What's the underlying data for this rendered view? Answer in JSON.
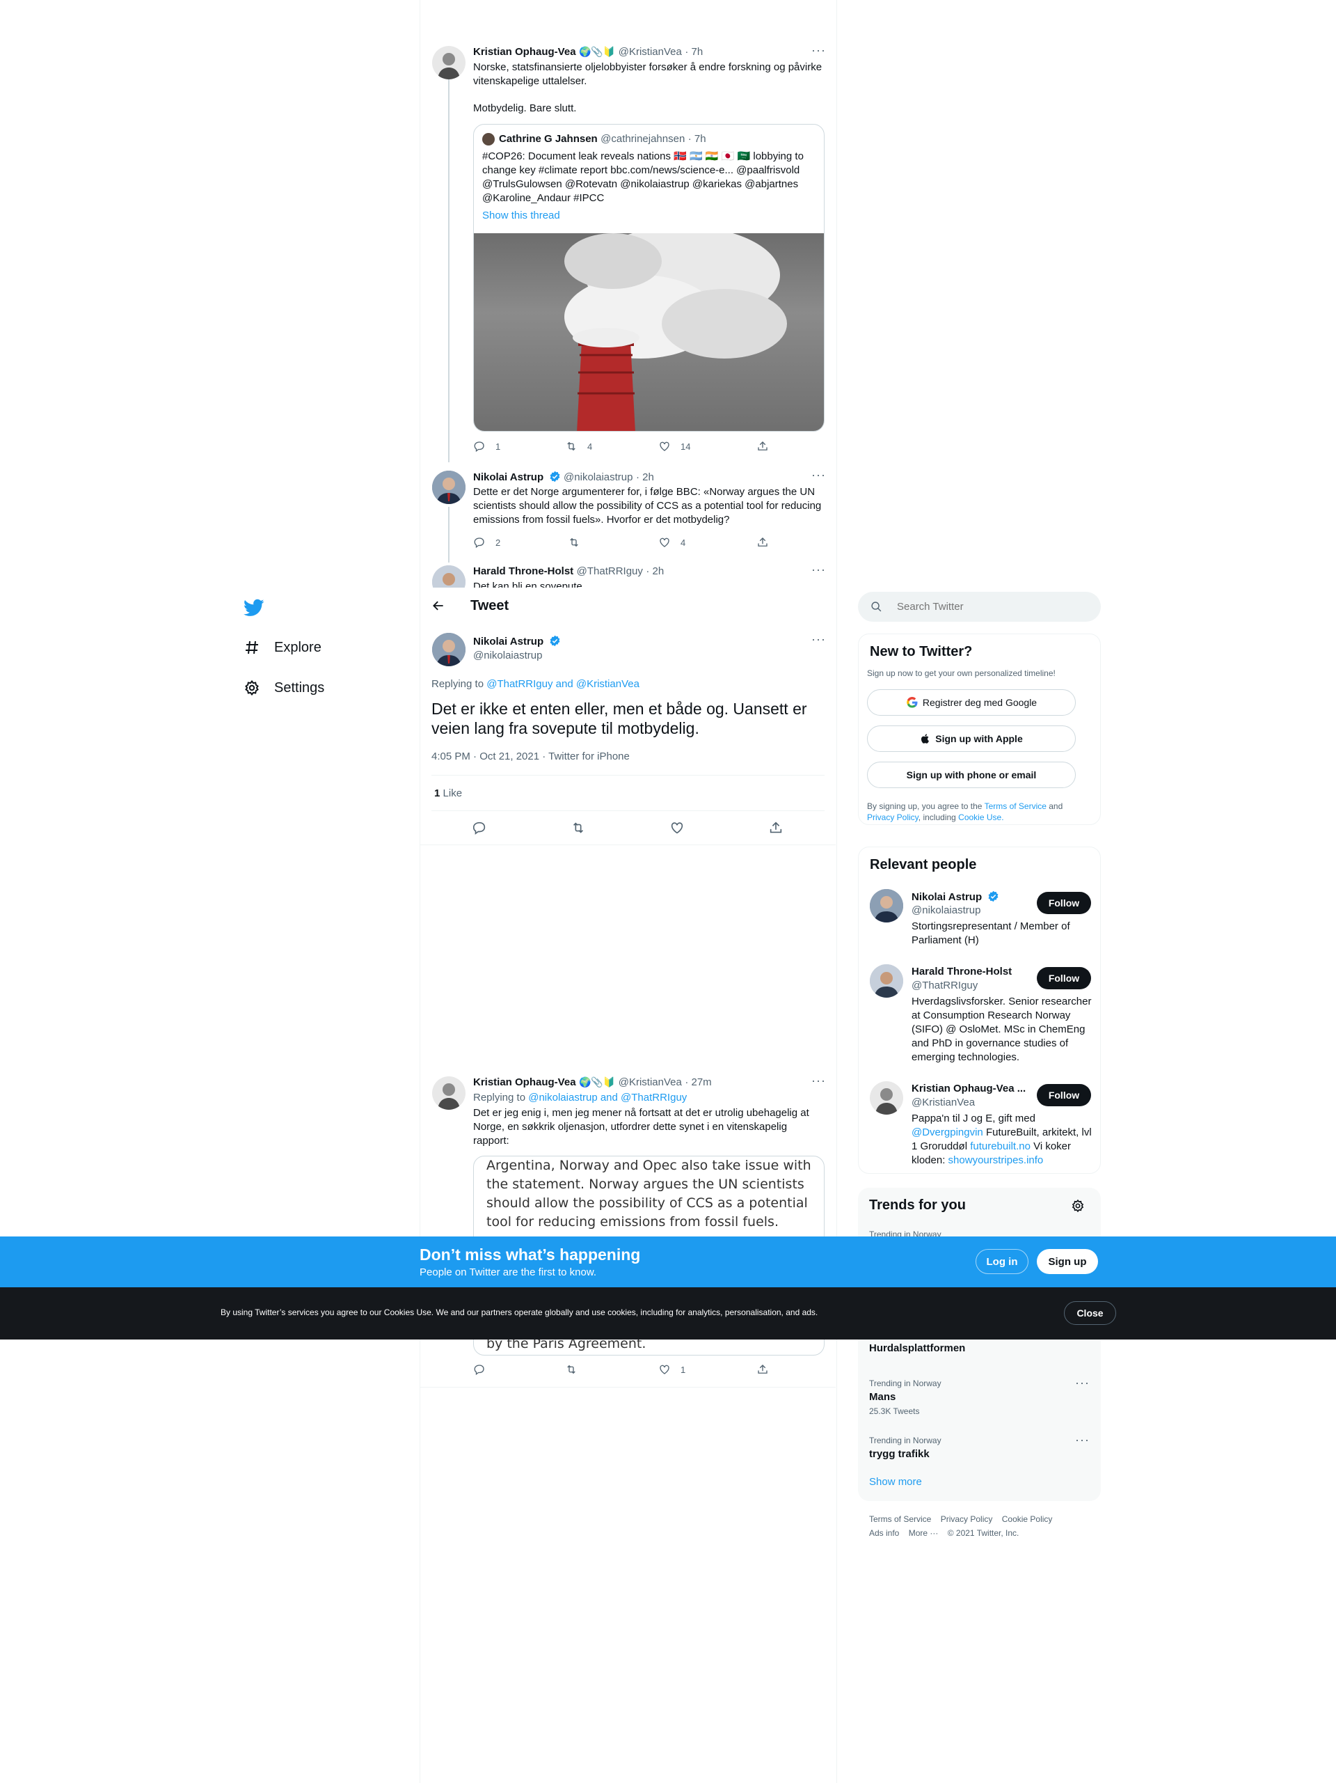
{
  "nav": {
    "explore": "Explore",
    "settings": "Settings"
  },
  "header": {
    "title": "Tweet"
  },
  "search": {
    "placeholder": "Search Twitter"
  },
  "thread": {
    "t1": {
      "name": "Kristian Ophaug-Vea",
      "emojis": "🌍📎🔰",
      "handle": "@KristianVea",
      "time": "· 7h",
      "text1": "Norske, statsfinansierte oljelobbyister forsøker å endre forskning og påvirke vitenskapelige uttalelser.",
      "text2": "Motbydelig. Bare slutt.",
      "quote": {
        "name": "Cathrine G Jahnsen",
        "handle": "@cathrinejahnsen",
        "time": "· 7h",
        "text_a": "#COP26: Document leak reveals nations 🇳🇴 🇦🇷 🇮🇳 🇯🇵 🇸🇦 lobbying to change key #climate report bbc.com/news/science-e... @paalfrisvold @TrulsGulowsen @Rotevatn @nikolaiastrup @kariekas @abjartnes @Karoline_Andaur #IPCC",
        "show_thread": "Show this thread"
      },
      "replies": "1",
      "retweets": "4",
      "likes": "14"
    },
    "t2": {
      "name": "Nikolai Astrup",
      "handle": "@nikolaiastrup",
      "time": "· 2h",
      "text": "Dette er det Norge argumenterer for, i følge BBC: «Norway argues the UN scientists should allow the possibility of CCS as a potential tool for reducing emissions from fossil fuels». Hvorfor er det motbydelig?",
      "replies": "2",
      "likes": "4"
    },
    "t3": {
      "name": "Harald Throne-Holst",
      "handle": "@ThatRRIguy",
      "time": "· 2h",
      "text": "Det kan bli en sovepute"
    }
  },
  "main_tweet": {
    "name": "Nikolai Astrup",
    "handle": "@nikolaiastrup",
    "replying_prefix": "Replying to ",
    "replying_to": "@ThatRRIguy and @KristianVea",
    "text": "Det er ikke et enten eller, men et både og. Uansett er veien lang fra sovepute til motbydelig.",
    "meta": "4:05 PM · Oct 21, 2021 · Twitter for iPhone",
    "like_count": "1",
    "like_label": "Like"
  },
  "reply": {
    "name": "Kristian Ophaug-Vea",
    "emojis": "🌍📎🔰",
    "handle": "@KristianVea",
    "time": "· 27m",
    "replying_prefix": "Replying to ",
    "replying_to": "@nikolaiastrup and @ThatRRIguy",
    "text": "Det er jeg enig i, men jeg mener nå fortsatt at det er utrolig ubehagelig at Norge, en søkkrik oljenasjon, utfordrer dette synet i en vitenskapelig rapport:",
    "quote_image_text": "Argentina, Norway and Opec also take issue with the statement. Norway argues the UN scientists should allow the possibility of CCS as a potential tool for reducing emissions from fossil fuels.",
    "quote_image_tail": "by the Paris Agreement.",
    "likes": "1"
  },
  "sidebar": {
    "new": {
      "title": "New to Twitter?",
      "sub": "Sign up now to get your own personalized timeline!",
      "google": "Registrer deg med Google",
      "apple": "Sign up with Apple",
      "phone": "Sign up with phone or email",
      "terms_a": "By signing up, you agree to the ",
      "terms_tos": "Terms of Service",
      "terms_b": " and ",
      "terms_pp": "Privacy Policy",
      "terms_c": ", including ",
      "terms_cookie": "Cookie Use."
    },
    "relevant": {
      "title": "Relevant people",
      "follow": "Follow",
      "people": [
        {
          "name": "Nikolai Astrup",
          "handle": "@nikolaiastrup",
          "bio": "Stortingsrepresentant / Member of Parliament (H)"
        },
        {
          "name": "Harald Throne-Holst",
          "handle": "@ThatRRIguy",
          "bio": "Hverdagslivsforsker. Senior researcher at Consumption Research Norway (SIFO) @ OsloMet. MSc in ChemEng and PhD in governance studies of emerging technologies."
        },
        {
          "name": "Kristian Ophaug-Vea ...",
          "handle": "@KristianVea",
          "bio_a": "Pappa'n til J og E, gift med ",
          "bio_link1": "@Dvergpingvin",
          "bio_b": " FutureBuilt, arkitekt, lvl 1 Groruddøl ",
          "bio_link2": "futurebuilt.no",
          "bio_c": " Vi koker kloden: ",
          "bio_link3": "showyourstripes.info"
        }
      ]
    },
    "trends": {
      "title": "Trends for you",
      "partial_label": "Trending in Norway",
      "item1": "Hurdalsplattformen",
      "items": [
        {
          "label": "Trending in Norway",
          "name": "Mans",
          "count": "25.3K Tweets"
        },
        {
          "label": "Trending in Norway",
          "name": "trygg trafikk"
        }
      ],
      "show_more": "Show more"
    },
    "footer": {
      "tos": "Terms of Service",
      "privacy": "Privacy Policy",
      "cookie": "Cookie Policy",
      "ads": "Ads info",
      "more": "More ···",
      "copy": "© 2021 Twitter, Inc."
    }
  },
  "banner": {
    "title": "Don’t miss what’s happening",
    "sub": "People on Twitter are the first to know.",
    "login": "Log in",
    "signup": "Sign up"
  },
  "cookie": {
    "text": "By using Twitter’s services you agree to our Cookies Use. We and our partners operate globally and use cookies, including for analytics, personalisation, and ads.",
    "close": "Close"
  },
  "colors": {
    "accent": "#1d9bf0",
    "dark": "#0f1419",
    "muted": "#536471"
  }
}
